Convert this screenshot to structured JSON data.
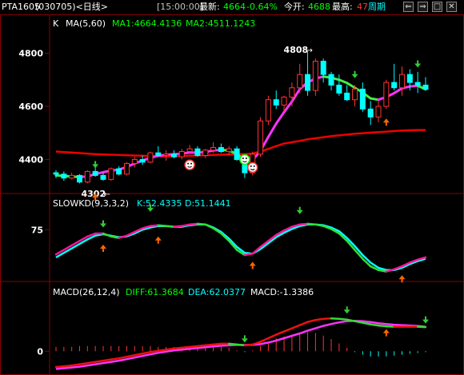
{
  "header": {
    "symbol": "PTA1605",
    "code_period": "(030705)<日线>",
    "time": "[15:00:00]",
    "latest_label": "最新:",
    "latest_value": "4664",
    "change_pct": "-0.64%",
    "open_label": "今开:",
    "open_value": "4688",
    "high_label": "最高:",
    "high_value": "47",
    "period_button": "周期",
    "colors": {
      "up": "#ff3333",
      "down": "#00ff00",
      "neutral": "#ffffff",
      "accent": "#ffff00"
    }
  },
  "window_buttons": [
    {
      "name": "back-icon",
      "glyph": "⇐"
    },
    {
      "name": "forward-icon",
      "glyph": "⇒"
    },
    {
      "name": "maximize-icon",
      "glyph": "□"
    },
    {
      "name": "close-icon",
      "glyph": "✕"
    }
  ],
  "chart_data": [
    {
      "type": "candlestick",
      "panel": "price",
      "label_prefix": "K",
      "ma_label": "MA(5,60)",
      "ma1_label": "MA1:4664.4136",
      "ma2_label": "MA2:4511.1243",
      "y_ticks": [
        4400,
        4600,
        4800
      ],
      "ylim": [
        4290,
        4880
      ],
      "high_annotation": "4808",
      "low_annotation": "4302",
      "grid": false,
      "candles": [
        [
          4350,
          4360,
          4330,
          4345
        ],
        [
          4345,
          4355,
          4320,
          4330
        ],
        [
          4330,
          4350,
          4325,
          4340
        ],
        [
          4340,
          4345,
          4310,
          4315
        ],
        [
          4315,
          4360,
          4310,
          4355
        ],
        [
          4355,
          4370,
          4335,
          4340
        ],
        [
          4340,
          4350,
          4320,
          4325
        ],
        [
          4325,
          4370,
          4320,
          4365
        ],
        [
          4365,
          4375,
          4340,
          4345
        ],
        [
          4345,
          4390,
          4340,
          4385
        ],
        [
          4385,
          4410,
          4370,
          4400
        ],
        [
          4400,
          4415,
          4380,
          4390
        ],
        [
          4390,
          4430,
          4385,
          4425
        ],
        [
          4425,
          4450,
          4410,
          4415
        ],
        [
          4415,
          4435,
          4395,
          4420
        ],
        [
          4420,
          4435,
          4405,
          4410
        ],
        [
          4410,
          4440,
          4400,
          4430
        ],
        [
          4430,
          4455,
          4420,
          4440
        ],
        [
          4440,
          4450,
          4410,
          4415
        ],
        [
          4415,
          4440,
          4405,
          4435
        ],
        [
          4435,
          4465,
          4425,
          4445
        ],
        [
          4445,
          4460,
          4425,
          4430
        ],
        [
          4430,
          4450,
          4415,
          4440
        ],
        [
          4440,
          4450,
          4395,
          4400
        ],
        [
          4400,
          4410,
          4330,
          4350
        ],
        [
          4350,
          4430,
          4340,
          4420
        ],
        [
          4420,
          4560,
          4410,
          4545
        ],
        [
          4545,
          4640,
          4530,
          4625
        ],
        [
          4625,
          4660,
          4590,
          4605
        ],
        [
          4605,
          4640,
          4580,
          4635
        ],
        [
          4635,
          4690,
          4600,
          4670
        ],
        [
          4670,
          4760,
          4650,
          4720
        ],
        [
          4720,
          4808,
          4640,
          4660
        ],
        [
          4660,
          4780,
          4640,
          4770
        ],
        [
          4770,
          4780,
          4690,
          4720
        ],
        [
          4720,
          4730,
          4660,
          4680
        ],
        [
          4680,
          4720,
          4640,
          4650
        ],
        [
          4650,
          4680,
          4620,
          4625
        ],
        [
          4625,
          4680,
          4600,
          4665
        ],
        [
          4665,
          4690,
          4580,
          4590
        ],
        [
          4590,
          4620,
          4530,
          4560
        ],
        [
          4560,
          4620,
          4540,
          4600
        ],
        [
          4600,
          4700,
          4590,
          4690
        ],
        [
          4690,
          4760,
          4660,
          4670
        ],
        [
          4670,
          4750,
          4640,
          4720
        ],
        [
          4720,
          4740,
          4660,
          4690
        ],
        [
          4690,
          4730,
          4650,
          4680
        ],
        [
          4680,
          4710,
          4660,
          4664
        ]
      ],
      "ma1": [
        4340,
        4338,
        4336,
        4334,
        4336,
        4345,
        4352,
        4358,
        4362,
        4372,
        4385,
        4396,
        4406,
        4414,
        4418,
        4420,
        4422,
        4426,
        4426,
        4428,
        4434,
        4436,
        4434,
        4420,
        4400,
        4398,
        4432,
        4485,
        4535,
        4578,
        4618,
        4665,
        4690,
        4705,
        4712,
        4708,
        4700,
        4688,
        4670,
        4652,
        4630,
        4625,
        4635,
        4650,
        4668,
        4675,
        4678,
        4664
      ],
      "ma2": [
        4430,
        4428,
        4426,
        4424,
        4422,
        4420,
        4419,
        4418,
        4417,
        4416,
        4415,
        4414,
        4413,
        4412,
        4412,
        4412,
        4413,
        4414,
        4415,
        4416,
        4417,
        4418,
        4419,
        4420,
        4420,
        4422,
        4430,
        4440,
        4450,
        4460,
        4465,
        4470,
        4476,
        4480,
        4484,
        4488,
        4491,
        4494,
        4497,
        4499,
        4501,
        4503,
        4505,
        4507,
        4509,
        4510,
        4511,
        4511
      ]
    },
    {
      "type": "line",
      "panel": "slowkd",
      "label": "SLOWKD(9,3,3,2)",
      "k_label": "K:52.4335",
      "d_label": "D:51.1441",
      "y_ticks": [
        75
      ],
      "ylim": [
        10,
        100
      ],
      "series": [
        {
          "key": "K",
          "values": [
            42,
            48,
            54,
            60,
            66,
            70,
            70,
            66,
            64,
            67,
            72,
            77,
            80,
            81,
            80,
            79,
            80,
            82,
            83,
            82,
            77,
            70,
            60,
            48,
            41,
            43,
            52,
            60,
            68,
            74,
            79,
            82,
            83,
            82,
            80,
            76,
            70,
            60,
            48,
            36,
            26,
            21,
            19,
            22,
            26,
            31,
            35,
            38
          ]
        },
        {
          "key": "D",
          "values": [
            38,
            44,
            50,
            56,
            62,
            67,
            69,
            67,
            65,
            66,
            70,
            75,
            78,
            80,
            80,
            79,
            79,
            81,
            82,
            82,
            78,
            72,
            63,
            52,
            44,
            43,
            49,
            57,
            65,
            71,
            76,
            80,
            82,
            82,
            81,
            78,
            73,
            64,
            53,
            41,
            31,
            24,
            21,
            21,
            24,
            29,
            33,
            36
          ]
        }
      ]
    },
    {
      "type": "line",
      "panel": "macd",
      "label": "MACD(26,12,4)",
      "diff_label": "DIFF:61.3684",
      "dea_label": "DEA:62.0377",
      "macd_label": "MACD:-1.3386",
      "y_ticks": [
        0
      ],
      "ylim": [
        -50,
        130
      ],
      "series": [
        {
          "key": "DIFF",
          "values": [
            -40,
            -38,
            -36,
            -33,
            -30,
            -27,
            -24,
            -21,
            -18,
            -14,
            -10,
            -6,
            -2,
            1,
            4,
            7,
            9,
            11,
            13,
            15,
            17,
            19,
            19,
            17,
            15,
            17,
            24,
            33,
            42,
            50,
            58,
            66,
            74,
            79,
            82,
            83,
            82,
            80,
            76,
            72,
            68,
            65,
            63,
            62,
            62,
            62,
            62,
            61
          ]
        },
        {
          "key": "DEA",
          "values": [
            -45,
            -43,
            -41,
            -39,
            -36,
            -33,
            -30,
            -27,
            -24,
            -20,
            -16,
            -12,
            -8,
            -4,
            -1,
            2,
            4,
            6,
            8,
            10,
            12,
            14,
            15,
            16,
            16,
            16,
            18,
            22,
            27,
            33,
            39,
            45,
            52,
            58,
            64,
            69,
            73,
            76,
            77,
            76,
            74,
            71,
            69,
            67,
            66,
            65,
            64,
            62
          ]
        }
      ],
      "histogram": [
        5,
        5,
        5,
        6,
        6,
        6,
        6,
        6,
        6,
        6,
        6,
        6,
        6,
        5,
        5,
        5,
        5,
        5,
        5,
        5,
        5,
        5,
        4,
        1,
        -1,
        1,
        6,
        11,
        15,
        17,
        19,
        21,
        22,
        21,
        18,
        14,
        9,
        4,
        -1,
        -4,
        -6,
        -6,
        -6,
        -5,
        -4,
        -3,
        -2,
        -1
      ]
    }
  ]
}
